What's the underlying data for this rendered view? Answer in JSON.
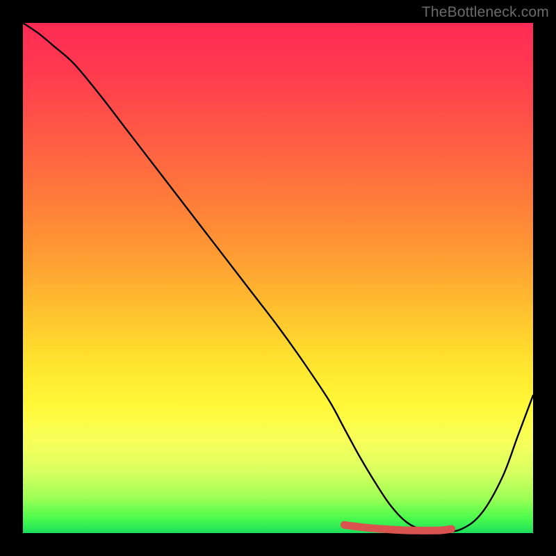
{
  "watermark": "TheBottleneck.com",
  "chart_data": {
    "type": "line",
    "title": "",
    "xlabel": "",
    "ylabel": "",
    "xlim": [
      0,
      100
    ],
    "ylim": [
      0,
      100
    ],
    "grid": false,
    "series": [
      {
        "name": "bottleneck-curve",
        "color": "#000000",
        "x": [
          0,
          3,
          6,
          10,
          15,
          20,
          25,
          30,
          35,
          40,
          45,
          50,
          55,
          60,
          63,
          66,
          69,
          72,
          75,
          78,
          82,
          86,
          90,
          94,
          97,
          100
        ],
        "y": [
          100,
          98,
          95.5,
          92,
          86,
          79.5,
          73,
          66.5,
          60,
          53.5,
          47,
          40.5,
          33.5,
          26,
          20.5,
          15,
          10,
          5.5,
          2.3,
          0.8,
          0.3,
          0.8,
          4,
          11,
          19,
          27
        ]
      },
      {
        "name": "optimal-band",
        "color": "#d9534f",
        "x": [
          63,
          66,
          69,
          72,
          75,
          78,
          80,
          82,
          84
        ],
        "y": [
          1.6,
          1.2,
          0.9,
          0.7,
          0.55,
          0.5,
          0.5,
          0.55,
          0.8
        ]
      }
    ],
    "gradient_stops": [
      {
        "pos": 0,
        "color": "#ff2a55"
      },
      {
        "pos": 10,
        "color": "#ff3b4f"
      },
      {
        "pos": 22,
        "color": "#ff5a45"
      },
      {
        "pos": 34,
        "color": "#ff7a3a"
      },
      {
        "pos": 45,
        "color": "#ff9a33"
      },
      {
        "pos": 56,
        "color": "#ffbf2e"
      },
      {
        "pos": 66,
        "color": "#ffe22e"
      },
      {
        "pos": 75,
        "color": "#fff838"
      },
      {
        "pos": 82,
        "color": "#f8ff5a"
      },
      {
        "pos": 88,
        "color": "#d8ff60"
      },
      {
        "pos": 93,
        "color": "#9fff55"
      },
      {
        "pos": 97,
        "color": "#4dfb4d"
      },
      {
        "pos": 100,
        "color": "#1be05a"
      }
    ]
  }
}
